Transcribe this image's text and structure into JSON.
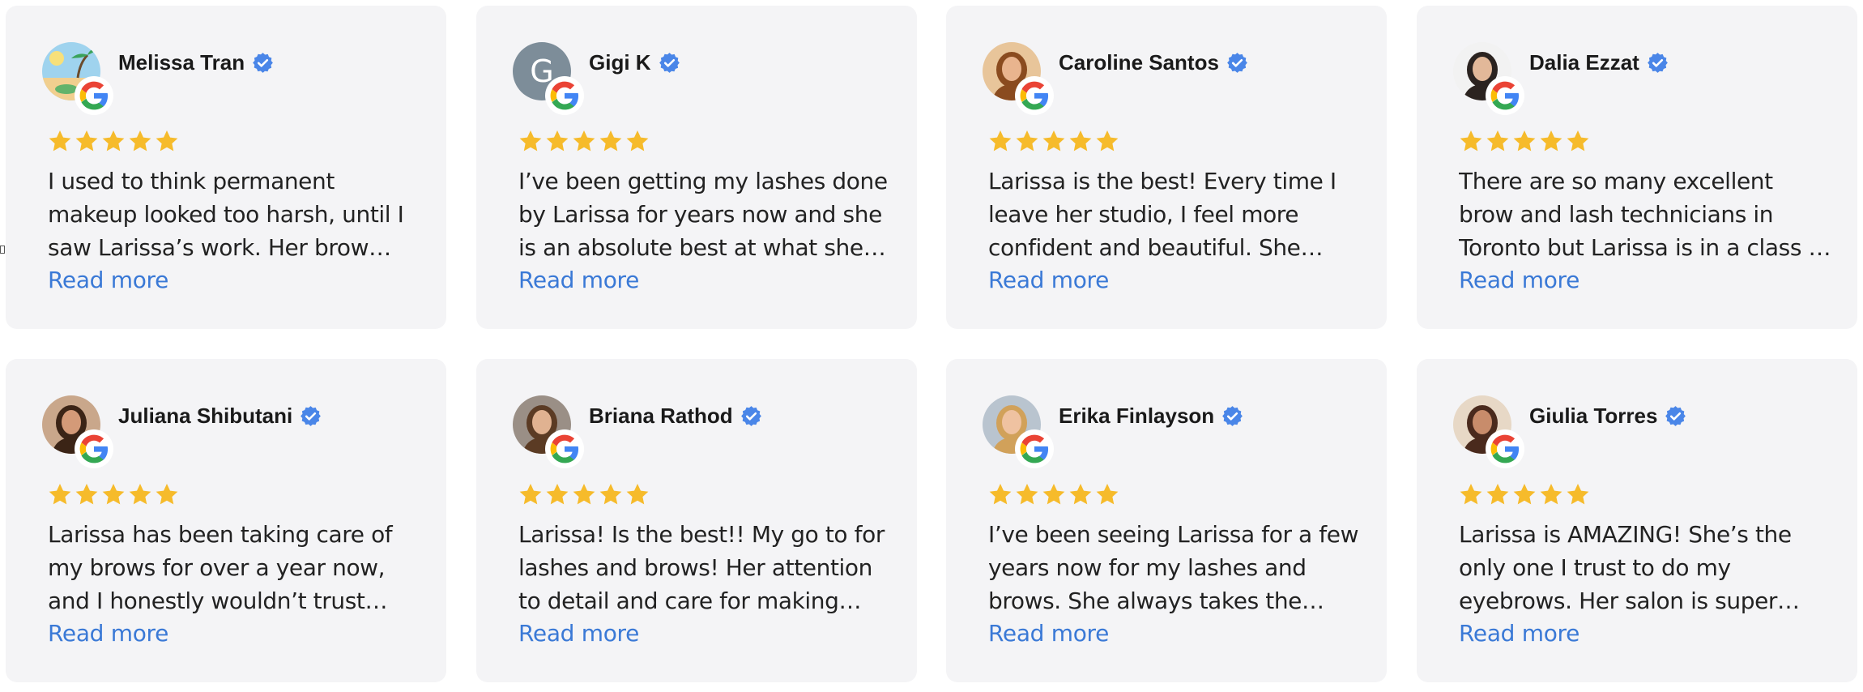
{
  "verified_color": "#4a86e8",
  "star_color": "#f6bb2b",
  "link_color": "#3a79d6",
  "badge_icon": "google-g-icon",
  "reviews": [
    {
      "name": "Melissa Tran",
      "avatar": "beach-illustration",
      "rating": 5,
      "text": "I used to think permanent makeup looked too harsh, until I saw Larissa’s work. Her brow artistry …",
      "read_more": "Read more"
    },
    {
      "name": "Gigi K",
      "avatar_letter": "G",
      "rating": 5,
      "text": "I’ve been getting my lashes done by Larissa for years now and she is an absolute best at what she doe…",
      "read_more": "Read more"
    },
    {
      "name": "Caroline Santos",
      "avatar": "photo",
      "rating": 5,
      "text": "Larissa is the best! Every time I leave her studio, I feel more confident and beautiful. She pay…",
      "read_more": "Read more"
    },
    {
      "name": "Dalia Ezzat",
      "avatar": "photo",
      "rating": 5,
      "text": "There are so many excellent brow and lash technicians in Toronto but Larissa is in a class of her own.…",
      "read_more": "Read more"
    },
    {
      "name": "Juliana Shibutani",
      "avatar": "photo",
      "rating": 5,
      "text": "Larissa has been taking care of my brows for over a year now, and I honestly wouldn’t trust anyone…",
      "read_more": "Read more"
    },
    {
      "name": "Briana Rathod",
      "avatar": "photo",
      "rating": 5,
      "text": "Larissa! Is the best!! My go to for lashes and brows! Her attention to detail and care for making her…",
      "read_more": "Read more"
    },
    {
      "name": "Erika Finlayson",
      "avatar": "photo",
      "rating": 5,
      "text": "I’ve been seeing Larissa for a few years now for my lashes and brows. She always takes the time…",
      "read_more": "Read more"
    },
    {
      "name": "Giulia Torres",
      "avatar": "photo",
      "rating": 5,
      "text": "Larissa is AMAZING! She’s the only one I trust to do my eyebrows. Her salon is super cut…",
      "read_more": "Read more"
    }
  ]
}
